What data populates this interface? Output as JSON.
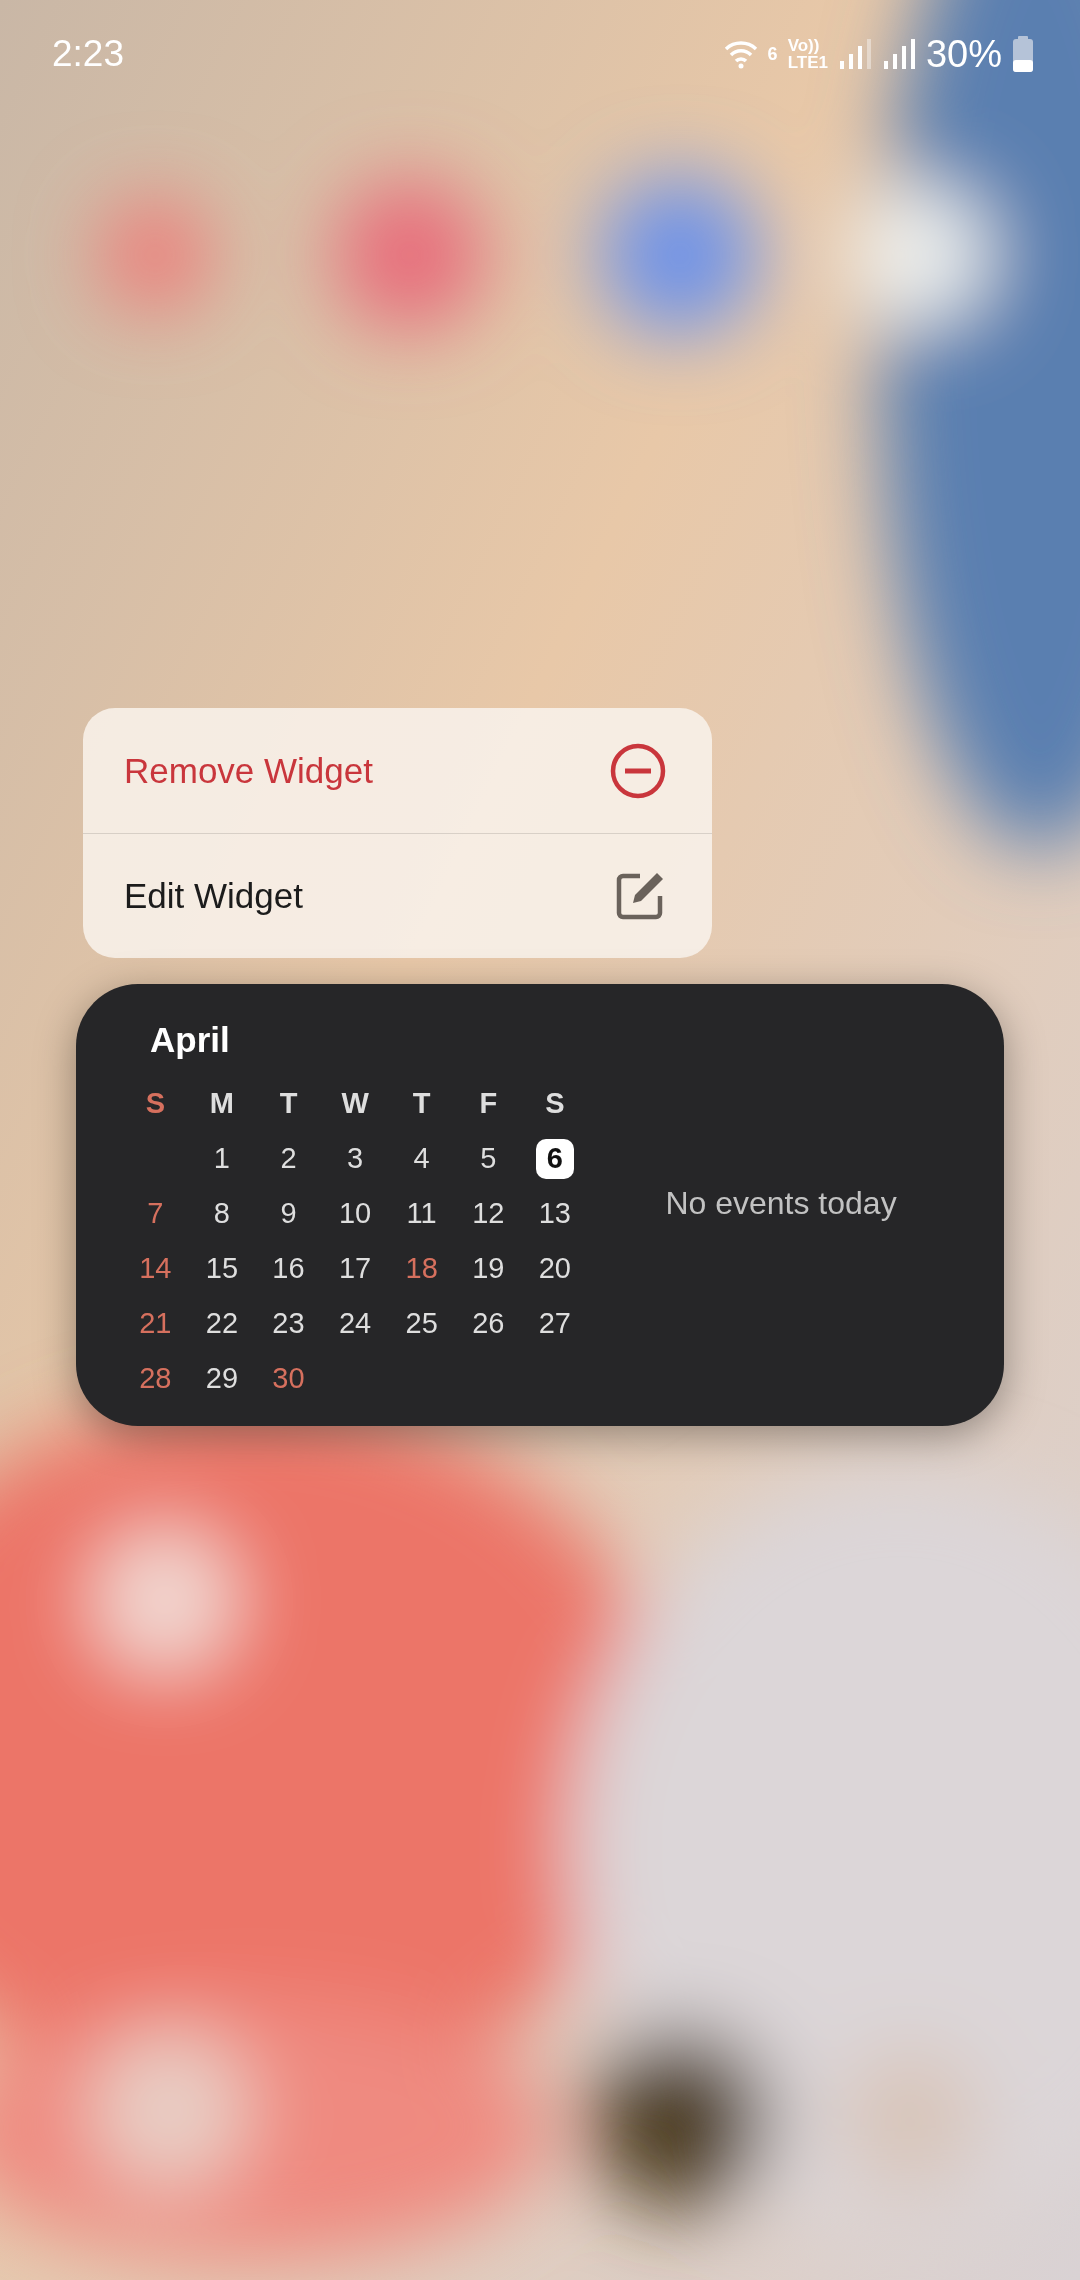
{
  "status_bar": {
    "time": "2:23",
    "wifi_label": "6",
    "volte_top": "Vo))",
    "volte_bottom": "LTE1",
    "battery": "30%"
  },
  "context_menu": [
    {
      "label": "Remove Widget",
      "kind": "remove"
    },
    {
      "label": "Edit Widget",
      "kind": "edit"
    }
  ],
  "calendar_widget": {
    "month": "April",
    "weekdays": [
      {
        "label": "S",
        "holiday": true
      },
      {
        "label": "M",
        "holiday": false
      },
      {
        "label": "T",
        "holiday": false
      },
      {
        "label": "W",
        "holiday": false
      },
      {
        "label": "T",
        "holiday": false
      },
      {
        "label": "F",
        "holiday": false
      },
      {
        "label": "S",
        "holiday": false
      }
    ],
    "weeks": [
      [
        {
          "kind": "blank"
        },
        {
          "kind": "day",
          "label": "1",
          "holiday": false,
          "selected": false
        },
        {
          "kind": "day",
          "label": "2",
          "holiday": false,
          "selected": false
        },
        {
          "kind": "day",
          "label": "3",
          "holiday": false,
          "selected": false
        },
        {
          "kind": "day",
          "label": "4",
          "holiday": false,
          "selected": false
        },
        {
          "kind": "day",
          "label": "5",
          "holiday": false,
          "selected": false
        },
        {
          "kind": "day",
          "label": "6",
          "holiday": false,
          "selected": true
        }
      ],
      [
        {
          "kind": "day",
          "label": "7",
          "holiday": true,
          "selected": false
        },
        {
          "kind": "day",
          "label": "8",
          "holiday": false,
          "selected": false
        },
        {
          "kind": "day",
          "label": "9",
          "holiday": false,
          "selected": false
        },
        {
          "kind": "day",
          "label": "10",
          "holiday": false,
          "selected": false
        },
        {
          "kind": "day",
          "label": "11",
          "holiday": false,
          "selected": false
        },
        {
          "kind": "day",
          "label": "12",
          "holiday": false,
          "selected": false
        },
        {
          "kind": "day",
          "label": "13",
          "holiday": false,
          "selected": false
        }
      ],
      [
        {
          "kind": "day",
          "label": "14",
          "holiday": true,
          "selected": false
        },
        {
          "kind": "day",
          "label": "15",
          "holiday": false,
          "selected": false
        },
        {
          "kind": "day",
          "label": "16",
          "holiday": false,
          "selected": false
        },
        {
          "kind": "day",
          "label": "17",
          "holiday": false,
          "selected": false
        },
        {
          "kind": "day",
          "label": "18",
          "holiday": true,
          "selected": false
        },
        {
          "kind": "day",
          "label": "19",
          "holiday": false,
          "selected": false
        },
        {
          "kind": "day",
          "label": "20",
          "holiday": false,
          "selected": false
        }
      ],
      [
        {
          "kind": "day",
          "label": "21",
          "holiday": true,
          "selected": false
        },
        {
          "kind": "day",
          "label": "22",
          "holiday": false,
          "selected": false
        },
        {
          "kind": "day",
          "label": "23",
          "holiday": false,
          "selected": false
        },
        {
          "kind": "day",
          "label": "24",
          "holiday": false,
          "selected": false
        },
        {
          "kind": "day",
          "label": "25",
          "holiday": false,
          "selected": false
        },
        {
          "kind": "day",
          "label": "26",
          "holiday": false,
          "selected": false
        },
        {
          "kind": "day",
          "label": "27",
          "holiday": false,
          "selected": false
        }
      ],
      [
        {
          "kind": "day",
          "label": "28",
          "holiday": true,
          "selected": false
        },
        {
          "kind": "day",
          "label": "29",
          "holiday": false,
          "selected": false
        },
        {
          "kind": "day",
          "label": "30",
          "holiday": true,
          "selected": false
        }
      ]
    ],
    "events_text": "No events today"
  }
}
